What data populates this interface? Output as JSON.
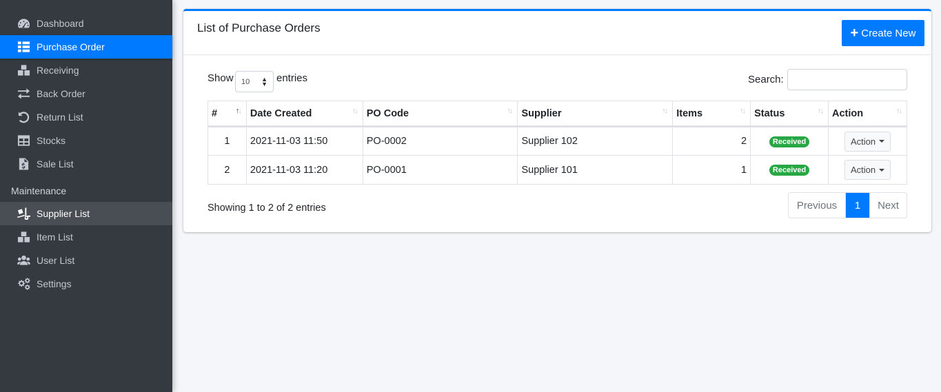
{
  "sidebar": {
    "items": [
      {
        "label": "Dashboard",
        "icon": "tachometer-icon"
      },
      {
        "label": "Purchase Order",
        "icon": "th-list-icon"
      },
      {
        "label": "Receiving",
        "icon": "boxes-icon"
      },
      {
        "label": "Back Order",
        "icon": "exchange-icon"
      },
      {
        "label": "Return List",
        "icon": "undo-icon"
      },
      {
        "label": "Stocks",
        "icon": "table-icon"
      },
      {
        "label": "Sale List",
        "icon": "file-invoice-dollar-icon"
      }
    ],
    "header": "Maintenance",
    "maintenance_items": [
      {
        "label": "Supplier List",
        "icon": "truck-loading-icon"
      },
      {
        "label": "Item List",
        "icon": "boxes-icon"
      },
      {
        "label": "User List",
        "icon": "users-icon"
      },
      {
        "label": "Settings",
        "icon": "cogs-icon"
      }
    ],
    "active_color": "#007bff"
  },
  "card": {
    "title": "List of Purchase Orders",
    "create_button": "Create New",
    "show_label": "Show",
    "entries_value": "10",
    "entries_label": "entries",
    "search_label": "Search:",
    "search_value": ""
  },
  "table": {
    "headers": [
      "#",
      "Date Created",
      "PO Code",
      "Supplier",
      "Items",
      "Status",
      "Action"
    ],
    "rows": [
      {
        "num": "1",
        "date": "2021-11-03 11:50",
        "code": "PO-0002",
        "supplier": "Supplier 102",
        "items": "2",
        "status": "Received",
        "action": "Action"
      },
      {
        "num": "2",
        "date": "2021-11-03 11:20",
        "code": "PO-0001",
        "supplier": "Supplier 101",
        "items": "1",
        "status": "Received",
        "action": "Action"
      }
    ],
    "status_color": "#28a745"
  },
  "footer": {
    "info": "Showing 1 to 2 of 2 entries",
    "previous": "Previous",
    "current_page": "1",
    "next": "Next"
  }
}
